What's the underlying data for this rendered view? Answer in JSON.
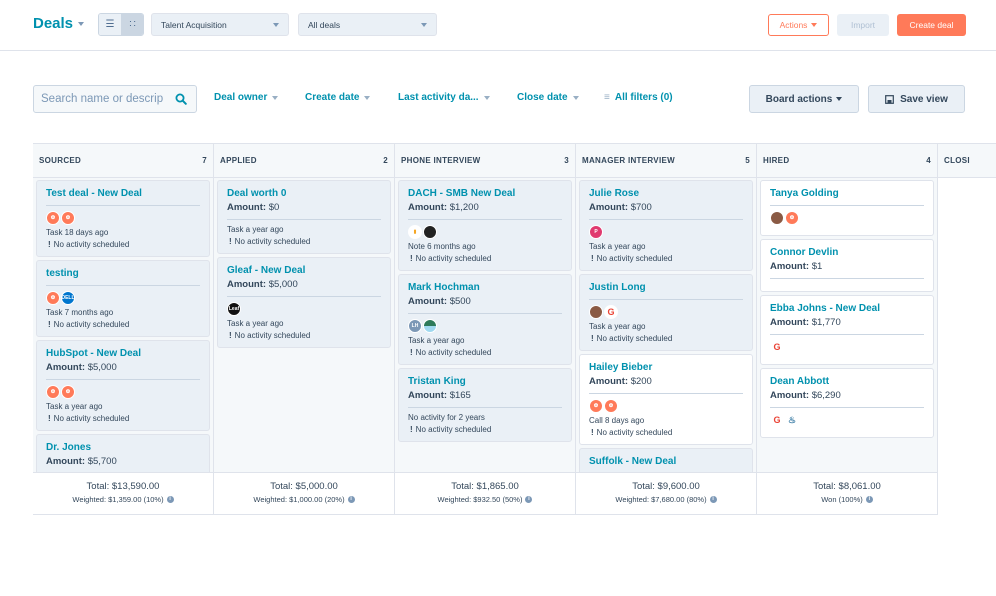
{
  "header": {
    "title": "Deals",
    "view_list_icon": "list-view-icon",
    "view_board_icon": "board-view-icon",
    "pipeline_select": "Talent Acquisition",
    "view_select": "All deals",
    "actions_label": "Actions",
    "import_label": "Import",
    "create_label": "Create deal"
  },
  "filters": {
    "search_placeholder": "Search name or descrip",
    "deal_owner": "Deal owner",
    "create_date": "Create date",
    "last_activity": "Last activity da...",
    "close_date": "Close date",
    "all_filters": "All filters (0)",
    "board_actions": "Board actions",
    "save_view": "Save view"
  },
  "colors": {
    "brand_teal": "#0091ae",
    "accent_orange": "#ff7a59",
    "text_dark": "#33475b",
    "card_bg": "#eaf0f6"
  },
  "columns": [
    {
      "name": "SOURCED",
      "count": "7",
      "total": "Total: $13,590.00",
      "weighted": "Weighted: $1,359.00 (10%)",
      "cards": [
        {
          "name": "Test deal - New Deal",
          "amount": "",
          "avatars": [
            "hubspot",
            "hubspot"
          ],
          "activity": "Task 18 days ago",
          "schedule": "No activity scheduled"
        },
        {
          "name": "testing",
          "amount": "",
          "avatars": [
            "hubspot",
            "dell"
          ],
          "activity": "Task 7 months ago",
          "schedule": "No activity scheduled"
        },
        {
          "name": "HubSpot - New Deal",
          "amount": "$5,000",
          "avatars": [
            "hubspot",
            "hubspot"
          ],
          "activity": "Task a year ago",
          "schedule": "No activity scheduled"
        },
        {
          "name": "Dr. Jones",
          "amount": "$5,700",
          "avatars": [],
          "activity": "",
          "schedule": ""
        }
      ]
    },
    {
      "name": "APPLIED",
      "count": "2",
      "total": "Total: $5,000.00",
      "weighted": "Weighted: $1,000.00 (20%)",
      "cards": [
        {
          "name": "Deal worth 0",
          "amount": "$0",
          "avatars": [],
          "activity": "Task a year ago",
          "schedule": "No activity scheduled"
        },
        {
          "name": "Gleaf - New Deal",
          "amount": "$5,000",
          "avatars": [
            "leaf"
          ],
          "activity": "Task a year ago",
          "schedule": "No activity scheduled"
        }
      ]
    },
    {
      "name": "PHONE INTERVIEW",
      "count": "3",
      "total": "Total: $1,865.00",
      "weighted": "Weighted: $932.50 (50%)",
      "cards": [
        {
          "name": "DACH - SMB New Deal",
          "amount": "$1,200",
          "avatars": [
            "yellow",
            "black"
          ],
          "activity": "Note 6 months ago",
          "schedule": "No activity scheduled"
        },
        {
          "name": "Mark Hochman",
          "amount": "$500",
          "avatars": [
            "lh",
            "wave"
          ],
          "activity": "Task a year ago",
          "schedule": "No activity scheduled"
        },
        {
          "name": "Tristan King",
          "amount": "$165",
          "avatars": [],
          "activity": "No activity for 2 years",
          "schedule": "No activity scheduled"
        }
      ]
    },
    {
      "name": "MANAGER INTERVIEW",
      "count": "5",
      "total": "Total: $9,600.00",
      "weighted": "Weighted: $7,680.00 (80%)",
      "cards": [
        {
          "name": "Julie Rose",
          "amount": "$700",
          "avatars": [
            "p"
          ],
          "activity": "Task a year ago",
          "schedule": "No activity scheduled"
        },
        {
          "name": "Justin Long",
          "amount": "",
          "avatars": [
            "photo",
            "google"
          ],
          "activity": "Task a year ago",
          "schedule": "No activity scheduled"
        },
        {
          "name": "Hailey Bieber",
          "amount": "$200",
          "avatars": [
            "hubspot",
            "hubspot"
          ],
          "activity": "Call 8 days ago",
          "schedule": "No activity scheduled",
          "white": true
        },
        {
          "name": "Suffolk - New Deal",
          "amount": "",
          "avatars": [],
          "activity": "",
          "schedule": ""
        }
      ]
    },
    {
      "name": "HIRED",
      "count": "4",
      "total": "Total: $8,061.00",
      "weighted": "Won (100%)",
      "cards": [
        {
          "name": "Tanya Golding",
          "amount": "",
          "avatars": [
            "photo",
            "hubspot"
          ],
          "activity": "",
          "schedule": "",
          "white": true
        },
        {
          "name": "Connor Devlin",
          "amount": "$1",
          "avatars": [],
          "activity": "",
          "schedule": "",
          "white": true
        },
        {
          "name": "Ebba Johns - New Deal",
          "amount": "$1,770",
          "avatars": [
            "google"
          ],
          "activity": "",
          "schedule": "",
          "white": true
        },
        {
          "name": "Dean Abbott",
          "amount": "$6,290",
          "avatars": [
            "google",
            "seat"
          ],
          "activity": "",
          "schedule": "",
          "white": true
        }
      ]
    },
    {
      "name": "CLOSI",
      "count": "",
      "total": "",
      "weighted": "",
      "cards": []
    }
  ],
  "labels": {
    "amount_prefix": "Amount:",
    "sched_bang": "!"
  }
}
